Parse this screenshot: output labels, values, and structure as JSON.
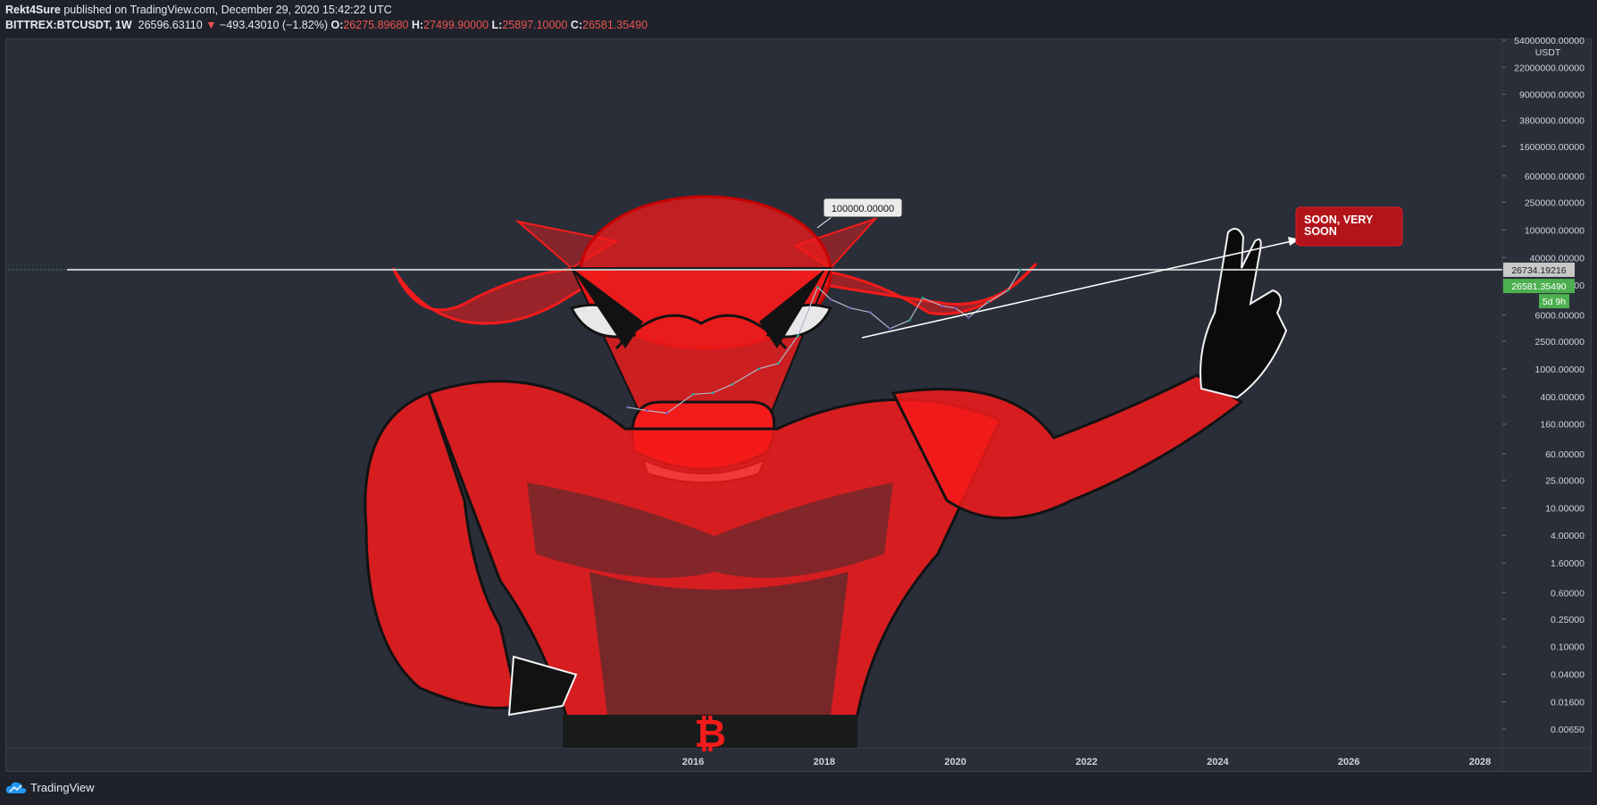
{
  "header": {
    "author": "Rekt4Sure",
    "published_text": "published on TradingView.com, December 29, 2020 15:42:22 UTC",
    "symbol": "BITTREX:BTCUSDT, 1W",
    "last_price": "26596.63110",
    "change_arrow": "▼",
    "change": "−493.43010 (−1.82%)",
    "open_label": "O:",
    "open": "26275.89680",
    "high_label": "H:",
    "high": "27499.90000",
    "low_label": "L:",
    "low": "25897.10000",
    "close_label": "C:",
    "close": "26581.35490"
  },
  "axis": {
    "currency": "USDT",
    "price_labels": {
      "line_price": "26734.19216",
      "last_close": "26581.35490",
      "countdown": "5d 9h"
    }
  },
  "annotations": {
    "callout_price": "100000.00000",
    "soon_text_line1": "SOON, VERY",
    "soon_text_line2": "SOON"
  },
  "footer": {
    "brand": "TradingView"
  },
  "colors": {
    "background": "#2a2e39",
    "up": "#26a69a",
    "down": "#ef5350",
    "figure_red": "#ff1a1a",
    "last_price_badge": "#4caf50"
  },
  "chart_data": {
    "type": "line",
    "title": "",
    "scale": "log",
    "ylabel": "USDT",
    "y_ticks": [
      "54000000.00000",
      "22000000.00000",
      "9000000.00000",
      "3800000.00000",
      "1600000.00000",
      "600000.00000",
      "250000.00000",
      "100000.00000",
      "40000.00000",
      "16000.00000",
      "6000.00000",
      "2500.00000",
      "1000.00000",
      "400.00000",
      "160.00000",
      "60.00000",
      "25.00000",
      "10.00000",
      "4.00000",
      "1.60000",
      "0.60000",
      "0.25000",
      "0.10000",
      "0.04000",
      "0.01600",
      "0.00650"
    ],
    "y_values": [
      54000000,
      22000000,
      9000000,
      3800000,
      1600000,
      600000,
      250000,
      100000,
      40000,
      16000,
      6000,
      2500,
      1000,
      400,
      160,
      60,
      25,
      10,
      4,
      1.6,
      0.6,
      0.25,
      0.1,
      0.04,
      0.016,
      0.0065
    ],
    "x_ticks": [
      "2016",
      "2018",
      "2020",
      "2022",
      "2024",
      "2026",
      "2028"
    ],
    "series": [
      {
        "x": [
          2015.0,
          2015.3,
          2015.6,
          2016.0,
          2016.3,
          2016.6,
          2017.0,
          2017.3,
          2017.6,
          2017.9,
          2018.1,
          2018.4,
          2018.7,
          2019.0,
          2019.3,
          2019.5,
          2019.8,
          2020.0,
          2020.2,
          2020.5,
          2020.8,
          2020.99
        ],
        "y": [
          280,
          250,
          230,
          430,
          450,
          600,
          1000,
          1200,
          3000,
          15000,
          10000,
          7500,
          6500,
          3800,
          5000,
          10500,
          8000,
          7500,
          5500,
          9200,
          13500,
          26581
        ]
      }
    ],
    "horizontal_line": 26734.19216
  }
}
